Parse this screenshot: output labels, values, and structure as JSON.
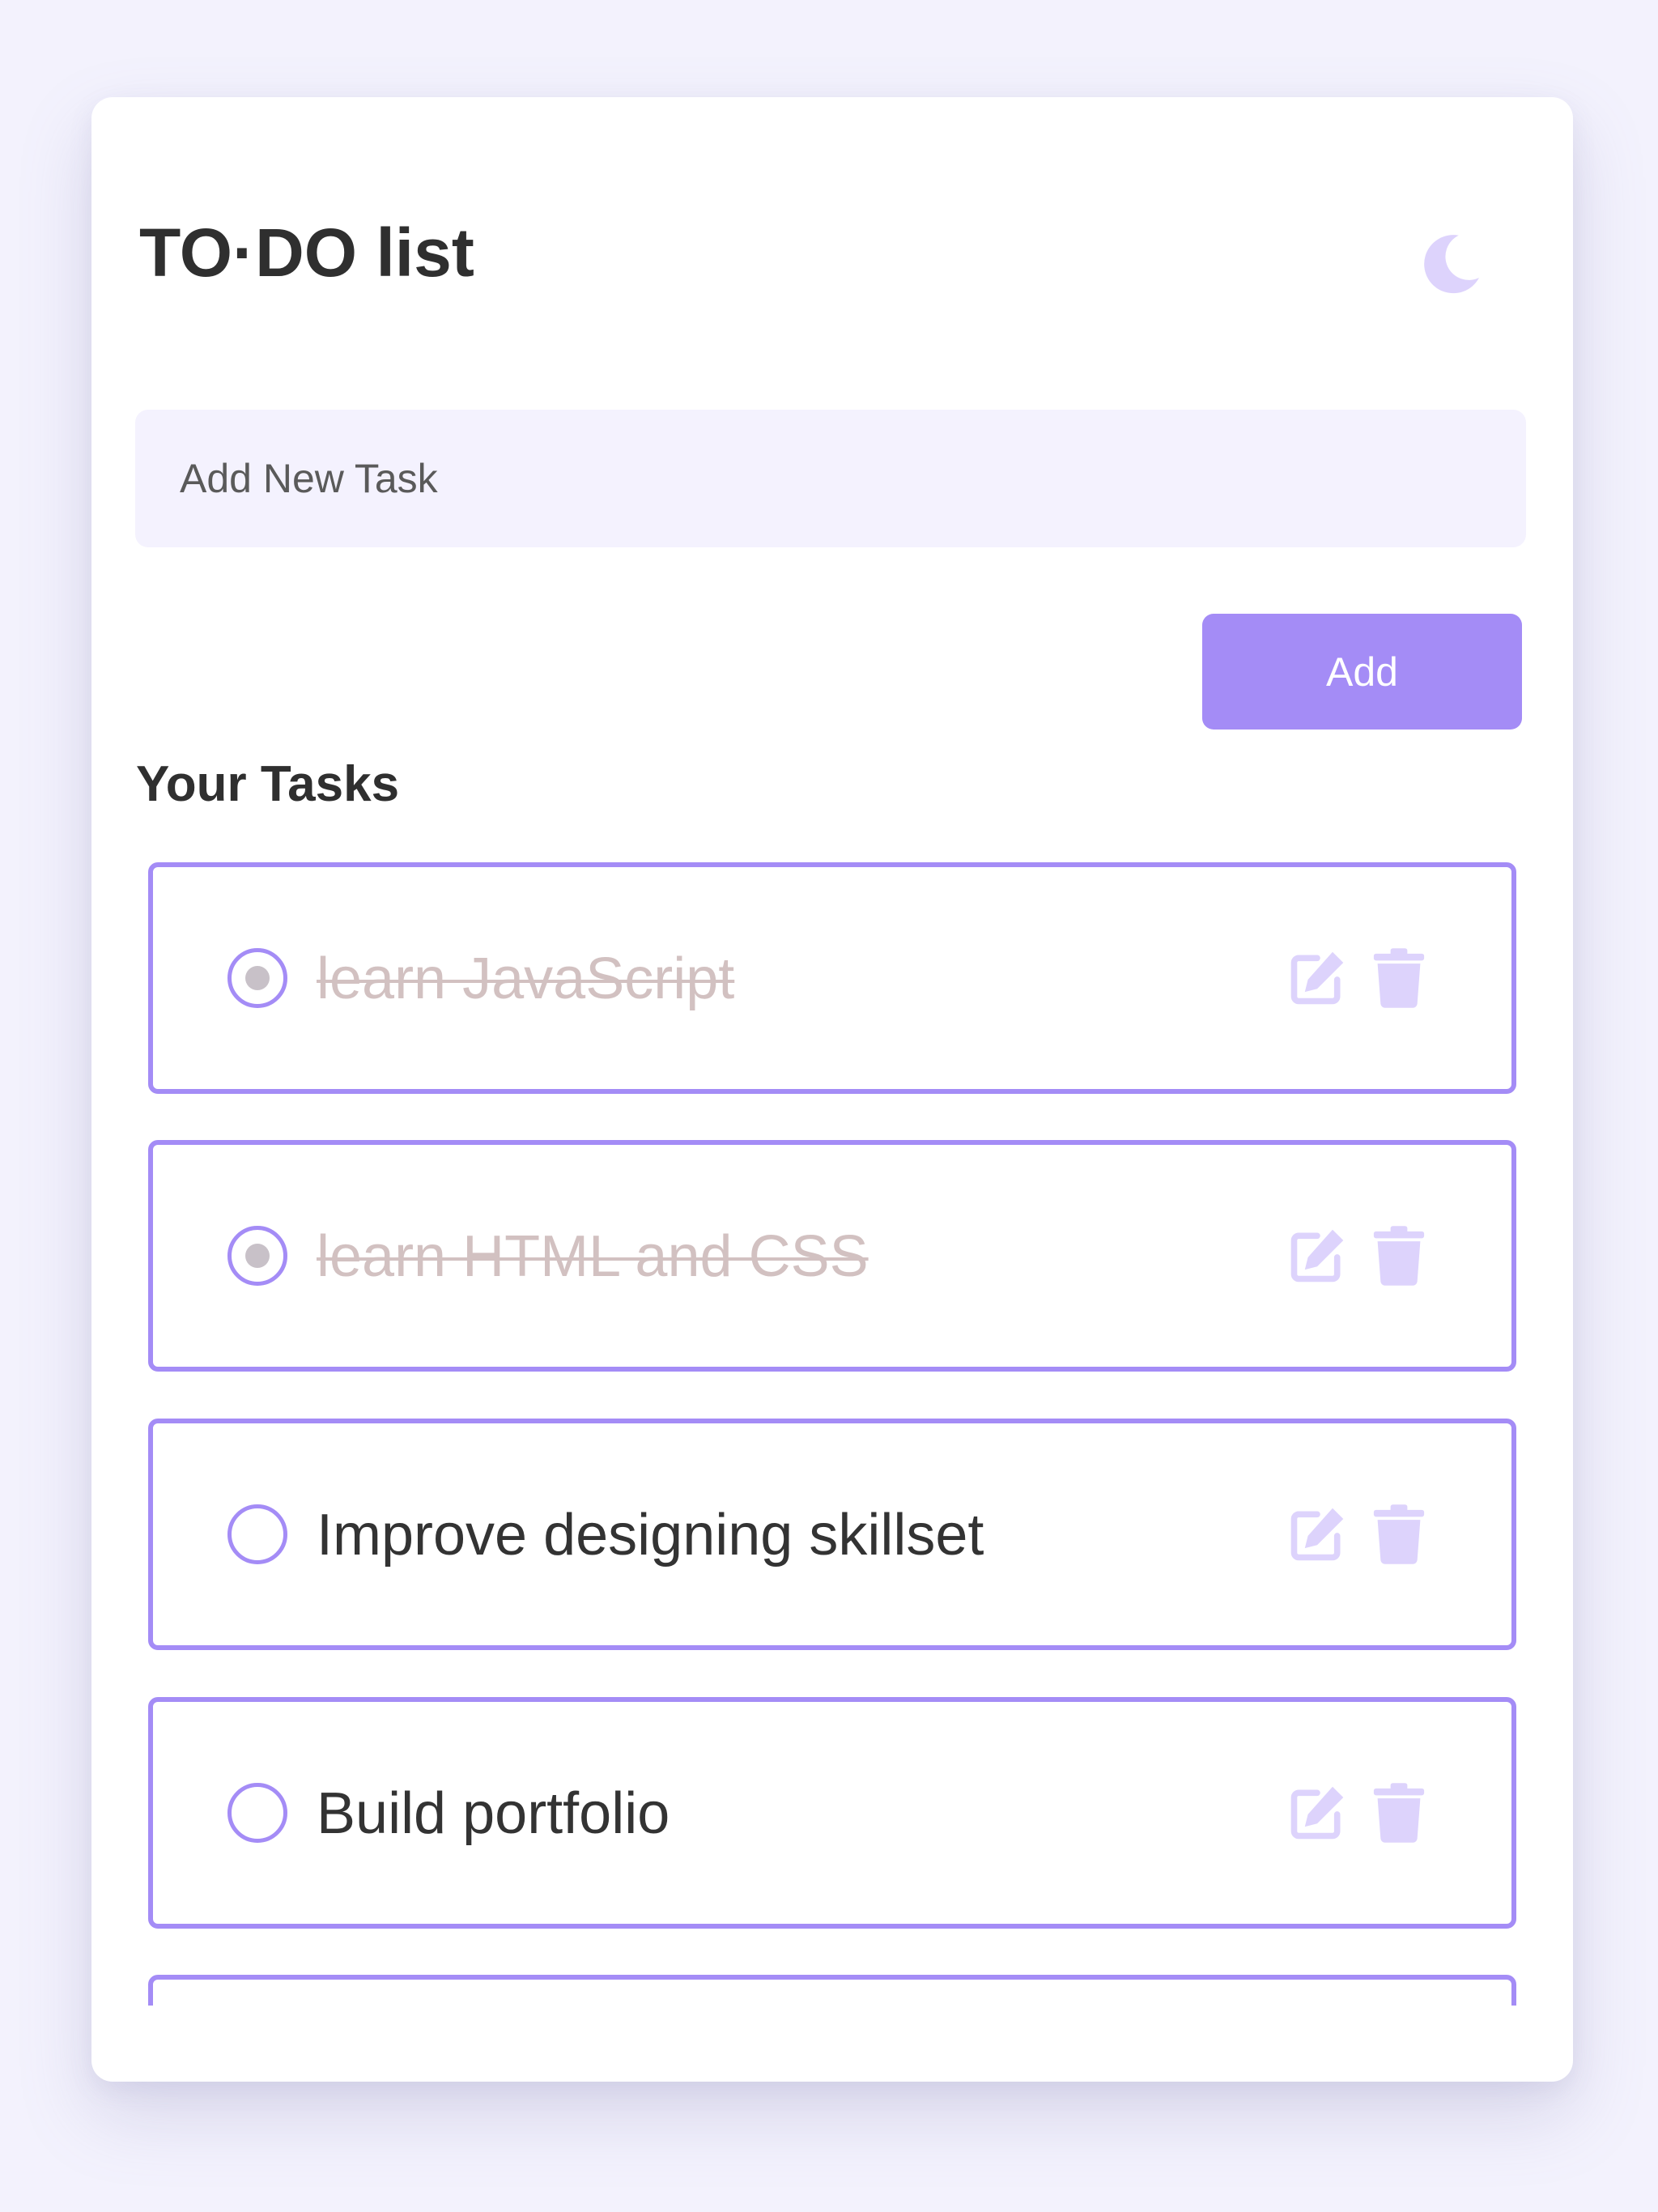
{
  "app": {
    "title": "TO·DO list",
    "theme_icon": "moon-icon"
  },
  "new_task": {
    "placeholder": "Add New Task",
    "value": ""
  },
  "add_button": {
    "label": "Add"
  },
  "tasks_section": {
    "title": "Your Tasks"
  },
  "tasks": [
    {
      "text": "learn JavaScript",
      "completed": true
    },
    {
      "text": "learn HTML and CSS",
      "completed": true
    },
    {
      "text": "Improve designing skillset",
      "completed": false
    },
    {
      "text": "Build portfolio",
      "completed": false
    }
  ],
  "icons": {
    "edit": "edit-icon",
    "delete": "trash-icon",
    "check": "radio-icon"
  },
  "colors": {
    "accent": "#a48cf6",
    "icon_light": "#ddd3fc",
    "background": "#f3f2fd",
    "input_bg": "#f4f2fe",
    "done_text": "#d2c1c1",
    "text": "#333333"
  }
}
